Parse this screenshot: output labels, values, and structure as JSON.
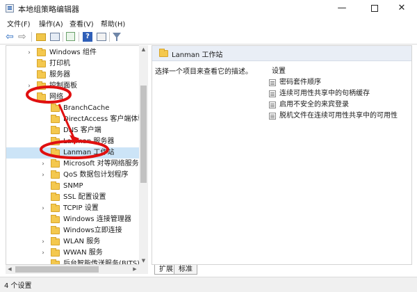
{
  "window": {
    "title": "本地组策略编辑器"
  },
  "title_buttons": {
    "minimize": "—",
    "close": "✕"
  },
  "menu": [
    "文件(F)",
    "操作(A)",
    "查看(V)",
    "帮助(H)"
  ],
  "toolbar": {
    "back_glyph": "⇦",
    "forward_glyph": "⇨",
    "help_glyph": "?"
  },
  "tree": {
    "rows": [
      {
        "label": "Windows 组件",
        "expander": "›",
        "level": 0
      },
      {
        "label": "打印机",
        "expander": "",
        "level": 0
      },
      {
        "label": "服务器",
        "expander": "",
        "level": 0
      },
      {
        "label": "控制面板",
        "expander": "›",
        "level": 0
      },
      {
        "label": "网络",
        "expander": "⌄",
        "level": 0
      },
      {
        "label": "BranchCache",
        "expander": "",
        "level": 1
      },
      {
        "label": "DirectAccess 客户端体验设",
        "expander": "",
        "level": 1
      },
      {
        "label": "DNS 客户端",
        "expander": "",
        "level": 1
      },
      {
        "label": "Lanman 服务器",
        "expander": "",
        "level": 1
      },
      {
        "label": "Lanman 工作站",
        "expander": "",
        "level": 1,
        "selected": true
      },
      {
        "label": "Microsoft 对等网络服务",
        "expander": "›",
        "level": 1
      },
      {
        "label": "QoS 数据包计划程序",
        "expander": "›",
        "level": 1
      },
      {
        "label": "SNMP",
        "expander": "",
        "level": 1
      },
      {
        "label": "SSL 配置设置",
        "expander": "",
        "level": 1
      },
      {
        "label": "TCPIP 设置",
        "expander": "›",
        "level": 1
      },
      {
        "label": "Windows 连接管理器",
        "expander": "",
        "level": 1
      },
      {
        "label": "Windows立即连接",
        "expander": "",
        "level": 1
      },
      {
        "label": "WLAN 服务",
        "expander": "›",
        "level": 1
      },
      {
        "label": "WWAN 服务",
        "expander": "›",
        "level": 1
      },
      {
        "label": "后台智能传送服务(BITS)",
        "expander": "",
        "level": 1
      }
    ]
  },
  "scroll": {
    "up": "▲",
    "down": "▼",
    "left": "◀",
    "right": "▶"
  },
  "right_panel": {
    "header_title": "Lanman 工作站",
    "description": "选择一个项目来查看它的描述。",
    "settings_header": "设置",
    "settings": [
      "密码套件顺序",
      "连续可用性共享中的句柄缓存",
      "启用不安全的来宾登录",
      "脱机文件在连续可用性共享中的可用性"
    ]
  },
  "tabs": [
    "扩展",
    "标准"
  ],
  "status": {
    "text": "4 个设置"
  },
  "annotation": {
    "color": "#e01010"
  }
}
